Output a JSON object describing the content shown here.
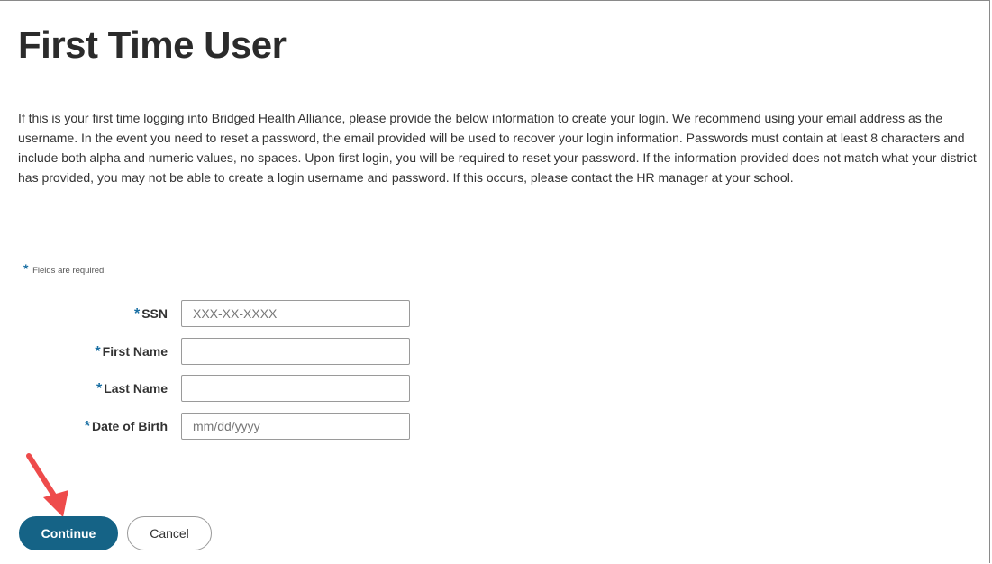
{
  "page": {
    "title": "First Time User",
    "intro": "If this is your first time logging into Bridged Health Alliance, please provide the below information to create your login. We recommend using your email address as the username. In the event you need to reset a password, the email provided will be used to recover your login information. Passwords must contain at least 8 characters and include both alpha and numeric values, no spaces. Upon first login, you will be required to reset your password. If the information provided does not match what your district has provided, you may not be able to create a login username and password. If this occurs, please contact the HR manager at your school."
  },
  "form": {
    "required_star": "*",
    "required_note": "Fields are required.",
    "ssn": {
      "label": "SSN",
      "placeholder": "XXX-XX-XXXX",
      "value": ""
    },
    "first_name": {
      "label": "First Name",
      "placeholder": "",
      "value": ""
    },
    "last_name": {
      "label": "Last Name",
      "placeholder": "",
      "value": ""
    },
    "dob": {
      "label": "Date of Birth",
      "placeholder": "mm/dd/yyyy",
      "value": ""
    }
  },
  "buttons": {
    "continue_label": "Continue",
    "cancel_label": "Cancel"
  },
  "colors": {
    "accent": "#156386",
    "required_star": "#1a6fa3",
    "annotation_arrow": "#ee4b4b"
  }
}
